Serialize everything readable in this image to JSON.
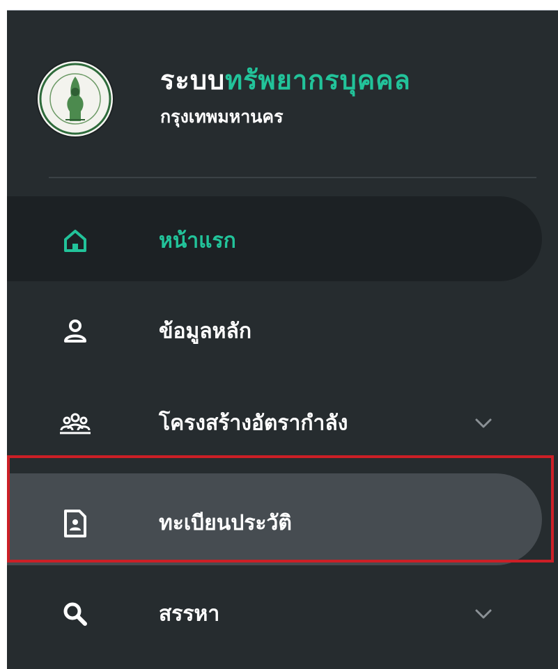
{
  "header": {
    "brand_prefix": "ระบบ",
    "brand_highlight": "ทรัพยากรบุคคล",
    "subtitle": "กรุงเทพมหานคร"
  },
  "nav": {
    "items": [
      {
        "label": "หน้าแรก",
        "icon": "home-icon",
        "active": true
      },
      {
        "label": "ข้อมูลหลัก",
        "icon": "user-icon"
      },
      {
        "label": "โครงสร้างอัตรากำลัง",
        "icon": "users-group-icon",
        "expandable": true
      },
      {
        "label": "ทะเบียนประวัติ",
        "icon": "id-document-icon",
        "hover": true
      },
      {
        "label": "สรรหา",
        "icon": "search-icon",
        "expandable": true
      }
    ]
  },
  "colors": {
    "sidebar_bg": "#262c2f",
    "accent": "#22c39a",
    "highlight_border": "#cc1f26"
  }
}
